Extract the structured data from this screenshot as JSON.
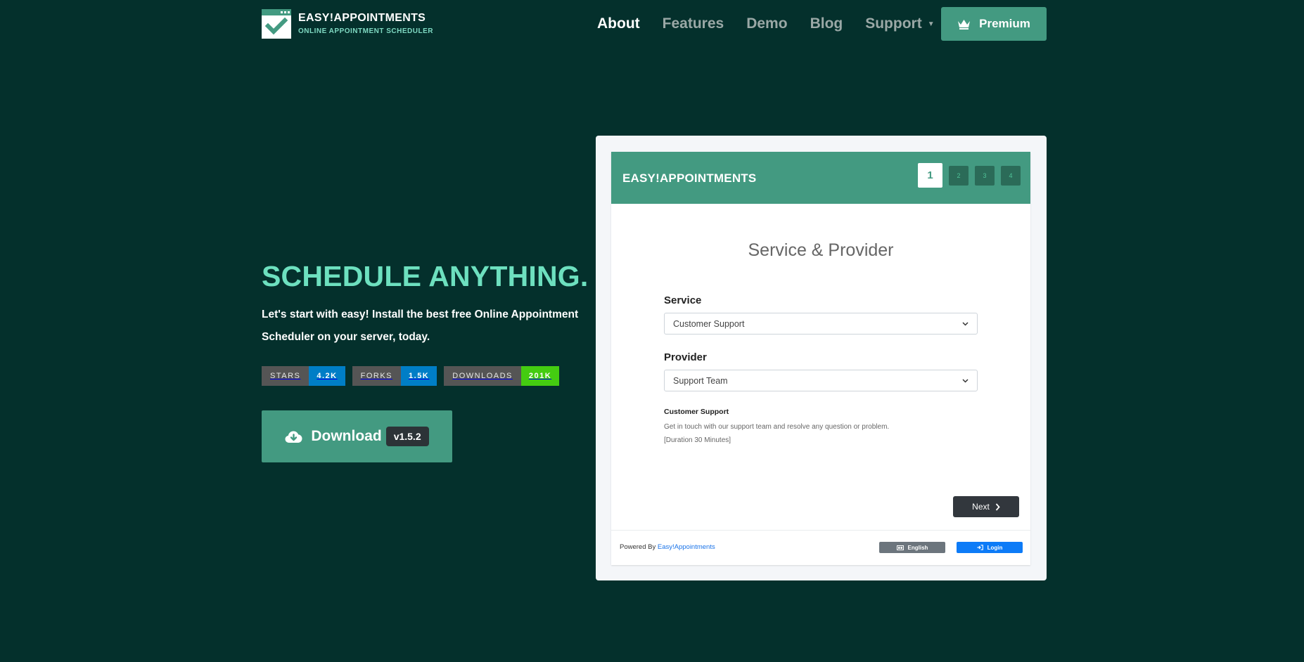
{
  "brand": {
    "title": "EASY!APPOINTMENTS",
    "subtitle": "ONLINE APPOINTMENT SCHEDULER",
    "icon": "calendar-check-icon"
  },
  "nav": {
    "items": [
      {
        "label": "About",
        "active": true
      },
      {
        "label": "Features",
        "active": false
      },
      {
        "label": "Demo",
        "active": false
      },
      {
        "label": "Blog",
        "active": false
      },
      {
        "label": "Support",
        "active": false,
        "dropdown": true
      }
    ],
    "premium": {
      "label": "Premium",
      "icon": "crown-icon"
    }
  },
  "hero": {
    "title": "SCHEDULE ANYTHING.",
    "lead": "Let's start with easy! Install the best free Online Appointment Scheduler on your server, today.",
    "badges": [
      {
        "label": "STARS",
        "value": "4.2K",
        "color": "#007ec6"
      },
      {
        "label": "FORKS",
        "value": "1.5K",
        "color": "#007ec6"
      },
      {
        "label": "DOWNLOADS",
        "value": "201K",
        "color": "#4c1"
      }
    ],
    "download": {
      "label": "Download",
      "version": "v1.5.2",
      "icon": "cloud-download-icon"
    }
  },
  "preview": {
    "header_title": "EASY!APPOINTMENTS",
    "steps": [
      "1",
      "2",
      "3",
      "4"
    ],
    "active_step": "1",
    "heading": "Service & Provider",
    "service_label": "Service",
    "service_value": "Customer Support",
    "provider_label": "Provider",
    "provider_value": "Support Team",
    "desc_title": "Customer Support",
    "desc_text": "Get in touch with our support team and resolve any question or problem.",
    "desc_duration": "[Duration 30 Minutes]",
    "next_label": "Next",
    "powered_prefix": "Powered By ",
    "powered_link": "Easy!Appointments",
    "language_label": "English",
    "login_label": "Login"
  },
  "colors": {
    "background": "#04302c",
    "accent": "#439a81",
    "hero_title": "#6de0bf"
  }
}
